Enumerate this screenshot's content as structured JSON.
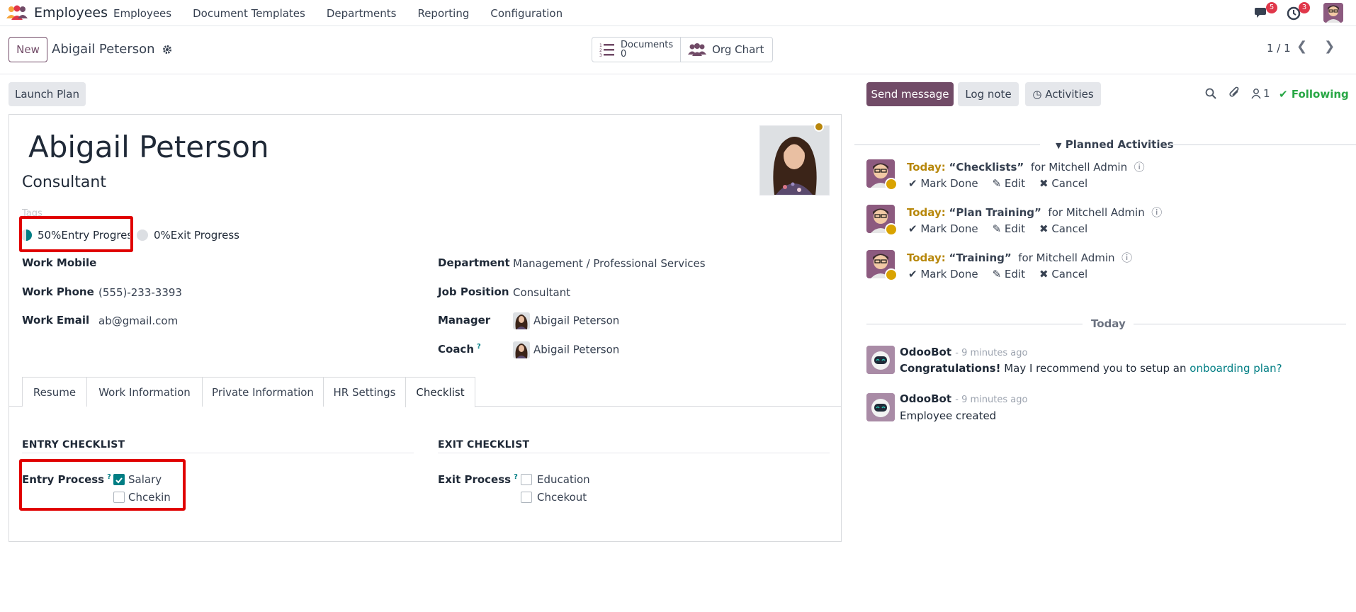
{
  "topnav": {
    "app_name": "Employees",
    "menu": [
      "Employees",
      "Document Templates",
      "Departments",
      "Reporting",
      "Configuration"
    ],
    "messages_badge": "5",
    "activities_badge": "3"
  },
  "control_panel": {
    "new_label": "New",
    "record_title": "Abigail Peterson",
    "documents_label": "Documents",
    "documents_count": "0",
    "org_chart_label": "Org Chart",
    "pager": "1 / 1"
  },
  "form": {
    "launch_plan": "Launch Plan",
    "name": "Abigail Peterson",
    "job_title": "Consultant",
    "tags_placeholder": "Tags",
    "entry_progress": "50%Entry Progress",
    "entry_progress_value": 0.5,
    "exit_progress": "0%Exit Progress",
    "exit_progress_value": 0,
    "left_fields": [
      {
        "label": "Work Mobile",
        "value": ""
      },
      {
        "label": "Work Phone",
        "value": "(555)-233-3393"
      },
      {
        "label": "Work Email",
        "value": "ab@gmail.com"
      }
    ],
    "right_fields": [
      {
        "label": "Department",
        "value": "Management / Professional Services"
      },
      {
        "label": "Job Position",
        "value": "Consultant"
      },
      {
        "label": "Manager",
        "value": "Abigail Peterson"
      },
      {
        "label": "Coach",
        "value": "Abigail Peterson"
      }
    ],
    "tabs": [
      "Resume",
      "Work Information",
      "Private Information",
      "HR Settings",
      "Checklist"
    ],
    "active_tab": "Checklist",
    "entry_checklist": {
      "title": "ENTRY CHECKLIST",
      "label": "Entry Process",
      "items": [
        {
          "label": "Salary",
          "checked": true
        },
        {
          "label": "Chcekin",
          "checked": false
        }
      ]
    },
    "exit_checklist": {
      "title": "EXIT CHECKLIST",
      "label": "Exit Process",
      "items": [
        {
          "label": "Education",
          "checked": false
        },
        {
          "label": "Chcekout",
          "checked": false
        }
      ]
    }
  },
  "chatter": {
    "send_message": "Send message",
    "log_note": "Log note",
    "activities": "Activities",
    "followers_count": "1",
    "following": "Following",
    "planned_title": "Planned Activities",
    "activities_list": [
      {
        "when": "Today:",
        "name": "“Checklists”",
        "for": "for Mitchell Admin"
      },
      {
        "when": "Today:",
        "name": "“Plan Training”",
        "for": "for Mitchell Admin"
      },
      {
        "when": "Today:",
        "name": "“Training”",
        "for": "for Mitchell Admin"
      }
    ],
    "mark_done": "Mark Done",
    "edit": "Edit",
    "cancel": "Cancel",
    "today_sep": "Today",
    "messages": [
      {
        "author": "OdooBot",
        "time": "- 9 minutes ago",
        "bold": "Congratulations!",
        "text": " May I recommend you to setup an ",
        "link": "onboarding plan?"
      },
      {
        "author": "OdooBot",
        "time": "- 9 minutes ago",
        "text": "Employee created"
      }
    ]
  }
}
